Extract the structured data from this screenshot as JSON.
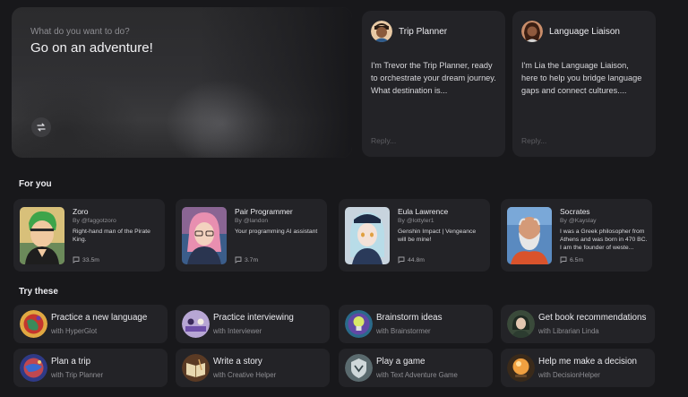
{
  "hero": {
    "question": "What do you want to do?",
    "title": "Go on an adventure!"
  },
  "featured": [
    {
      "name": "Trip Planner",
      "description": "I'm Trevor the Trip Planner, ready to orchestrate your dream journey. What destination is...",
      "reply_placeholder": "Reply..."
    },
    {
      "name": "Language Liaison",
      "description": "I'm Lia the Language Liaison, here to help you bridge language gaps and connect cultures....",
      "reply_placeholder": "Reply..."
    }
  ],
  "for_you": {
    "heading": "For you",
    "items": [
      {
        "name": "Zoro",
        "by": "By @faggotzoro",
        "description": "Right-hand man of the Pirate King.",
        "count": "33.5m"
      },
      {
        "name": "Pair Programmer",
        "by": "By @landon",
        "description": "Your programming AI assistant",
        "count": "3.7m"
      },
      {
        "name": "Eula Lawrence",
        "by": "By @lottyler1",
        "description": "Genshin Impact | Vengeance will be mine!",
        "count": "44.8m"
      },
      {
        "name": "Socrates",
        "by": "By @Kayslay",
        "description": "I was a Greek philosopher from Athens and was born in 470 BC. I am the founder of weste...",
        "count": "6.5m"
      }
    ]
  },
  "try_these": {
    "heading": "Try these",
    "items": [
      {
        "label": "Practice a new language",
        "sub": "with HyperGlot",
        "icon": "globe-icon"
      },
      {
        "label": "Practice interviewing",
        "sub": "with Interviewer",
        "icon": "interview-icon"
      },
      {
        "label": "Brainstorm ideas",
        "sub": "with Brainstormer",
        "icon": "lightbulb-icon"
      },
      {
        "label": "Get book recommendations",
        "sub": "with Librarian Linda",
        "icon": "librarian-icon"
      },
      {
        "label": "Plan a trip",
        "sub": "with Trip Planner",
        "icon": "planet-icon"
      },
      {
        "label": "Write a story",
        "sub": "with Creative Helper",
        "icon": "book-icon"
      },
      {
        "label": "Play a game",
        "sub": "with Text Adventure Game",
        "icon": "game-icon"
      },
      {
        "label": "Help me make a decision",
        "sub": "with DecisionHelper",
        "icon": "crystal-ball-icon"
      }
    ]
  }
}
